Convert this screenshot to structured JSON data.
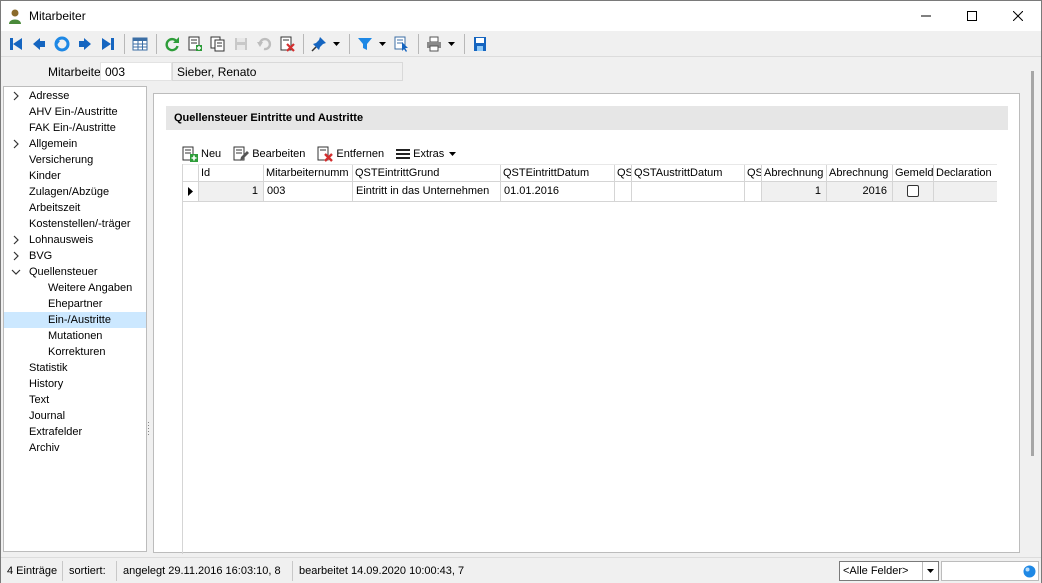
{
  "window": {
    "title": "Mitarbeiter"
  },
  "toolbar": {
    "icons": [
      "first-record-icon",
      "previous-record-icon",
      "undo-nav-icon",
      "next-record-icon",
      "last-record-icon",
      "table-view-icon",
      "refresh-icon",
      "new-record-icon",
      "copy-record-icon",
      "save-icon",
      "undo-icon",
      "delete-icon",
      "pin-icon",
      "filter-icon",
      "navigate-icon",
      "print-icon",
      "save-disk-icon"
    ]
  },
  "header": {
    "label": "Mitarbeiter",
    "id_value": "003",
    "name_value": "Sieber, Renato"
  },
  "tree": {
    "items": [
      {
        "label": "Adresse",
        "expander": "collapsed",
        "level": 0
      },
      {
        "label": "AHV Ein-/Austritte",
        "expander": "",
        "level": 0
      },
      {
        "label": "FAK Ein-/Austritte",
        "expander": "",
        "level": 0
      },
      {
        "label": "Allgemein",
        "expander": "collapsed",
        "level": 0
      },
      {
        "label": "Versicherung",
        "expander": "",
        "level": 0
      },
      {
        "label": "Kinder",
        "expander": "",
        "level": 0
      },
      {
        "label": "Zulagen/Abzüge",
        "expander": "",
        "level": 0
      },
      {
        "label": "Arbeitszeit",
        "expander": "",
        "level": 0
      },
      {
        "label": "Kostenstellen/-träger",
        "expander": "",
        "level": 0
      },
      {
        "label": "Lohnausweis",
        "expander": "collapsed",
        "level": 0
      },
      {
        "label": "BVG",
        "expander": "collapsed",
        "level": 0
      },
      {
        "label": "Quellensteuer",
        "expander": "expanded",
        "level": 0
      },
      {
        "label": "Weitere Angaben",
        "expander": "",
        "level": 1
      },
      {
        "label": "Ehepartner",
        "expander": "",
        "level": 1
      },
      {
        "label": "Ein-/Austritte",
        "expander": "",
        "level": 1,
        "selected": true
      },
      {
        "label": "Mutationen",
        "expander": "",
        "level": 1
      },
      {
        "label": "Korrekturen",
        "expander": "",
        "level": 1
      },
      {
        "label": "Statistik",
        "expander": "",
        "level": 0
      },
      {
        "label": "History",
        "expander": "",
        "level": 0
      },
      {
        "label": "Text",
        "expander": "",
        "level": 0
      },
      {
        "label": "Journal",
        "expander": "",
        "level": 0
      },
      {
        "label": "Extrafelder",
        "expander": "",
        "level": 0
      },
      {
        "label": "Archiv",
        "expander": "",
        "level": 0
      }
    ]
  },
  "section": {
    "title": "Quellensteuer Eintritte und Austritte"
  },
  "grid_toolbar": {
    "new_label": "Neu",
    "edit_label": "Bearbeiten",
    "remove_label": "Entfernen",
    "extras_label": "Extras"
  },
  "grid": {
    "columns": [
      "Id",
      "Mitarbeiternumm",
      "QSTEintrittGrund",
      "QSTEintrittDatum",
      "QS",
      "QSTAustrittDatum",
      "QS",
      "Abrechnung",
      "Abrechnung",
      "Gemeld",
      "Declaration"
    ],
    "rows": [
      {
        "id": "1",
        "mitarbeiternummer": "003",
        "eintritt_grund": "Eintritt in das Unternehmen",
        "eintritt_datum": "01.01.2016",
        "qs1": "",
        "austritt_datum": "",
        "qs2": "",
        "abrechnung1": "1",
        "abrechnung2": "2016",
        "gemeldet": false,
        "declaration": ""
      }
    ]
  },
  "statusbar": {
    "count": "4 Einträge",
    "sorted": "sortiert:",
    "created": "angelegt 29.11.2016 16:03:10,  8",
    "edited": "bearbeitet 14.09.2020 10:00:43,  7",
    "field_select": "<Alle Felder>",
    "search_value": ""
  },
  "colors": {
    "selection": "#cce8ff",
    "nav_blue": "#1565c0",
    "refresh_green": "#2e9d3a",
    "delete_red": "#d32f2f"
  }
}
